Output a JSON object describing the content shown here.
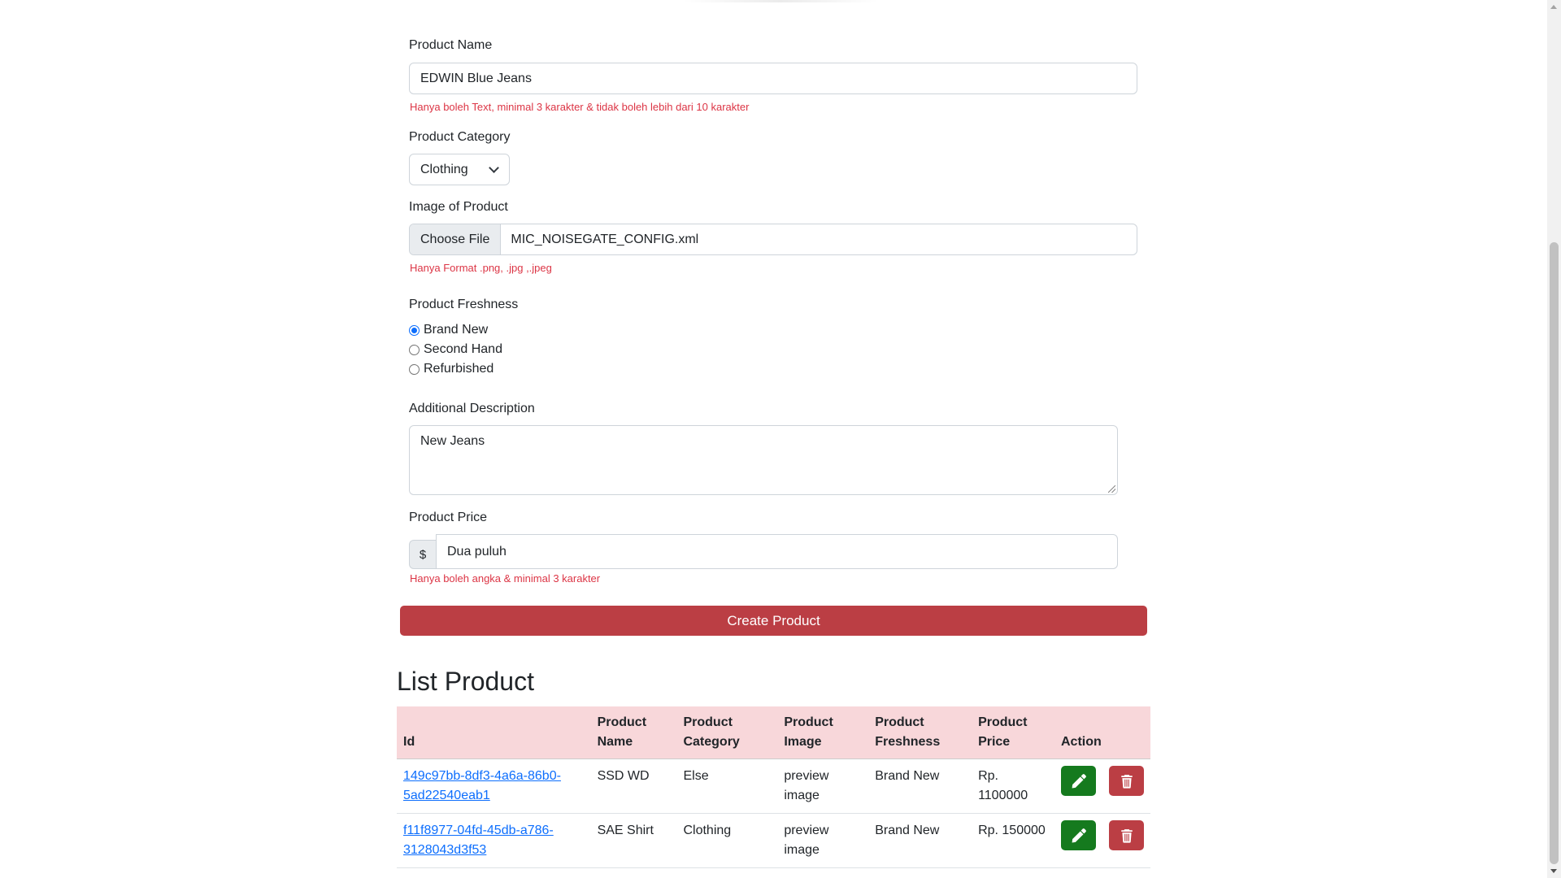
{
  "form": {
    "product_name": {
      "label": "Product Name",
      "value": "EDWIN Blue Jeans",
      "error": "Hanya boleh Text, minimal 3 karakter & tidak boleh lebih dari 10 karakter"
    },
    "product_category": {
      "label": "Product Category",
      "selected": "Clothing"
    },
    "image": {
      "label": "Image of Product",
      "button": "Choose File",
      "file_name": "MIC_NOISEGATE_CONFIG.xml",
      "error": "Hanya Format .png, .jpg ,.jpeg"
    },
    "freshness": {
      "label": "Product Freshness",
      "options": [
        "Brand New",
        "Second Hand",
        "Refurbished"
      ],
      "selected": "Brand New"
    },
    "description": {
      "label": "Additional Description",
      "value": "New Jeans"
    },
    "price": {
      "label": "Product Price",
      "prefix": "$",
      "value": "Dua puluh",
      "error": "Hanya boleh angka & minimal 3 karakter"
    },
    "submit_label": "Create Product"
  },
  "list": {
    "title": "List Product",
    "headers": [
      "Id",
      "Product Name",
      "Product Category",
      "Product Image",
      "Product Freshness",
      "Product Price",
      "Action"
    ],
    "rows": [
      {
        "id": "149c97bb-8df3-4a6a-86b0-5ad22540eab1",
        "name": "SSD WD",
        "category": "Else",
        "image_alt": "preview image",
        "freshness": "Brand New",
        "price": "Rp. 1100000"
      },
      {
        "id": "f11f8977-04fd-45db-a786-3128043d3f53",
        "name": "SAE Shirt",
        "category": "Clothing",
        "image_alt": "preview image",
        "freshness": "Brand New",
        "price": "Rp. 150000"
      }
    ]
  },
  "colors": {
    "error": "#dc3545",
    "create_button": "#bb3e44",
    "edit_button": "#157a1e",
    "delete_button": "#bb3e44",
    "table_header": "#f8d7da",
    "link": "#0d6efd"
  },
  "icons": {
    "edit": "pencil-icon",
    "delete": "trash-icon"
  }
}
